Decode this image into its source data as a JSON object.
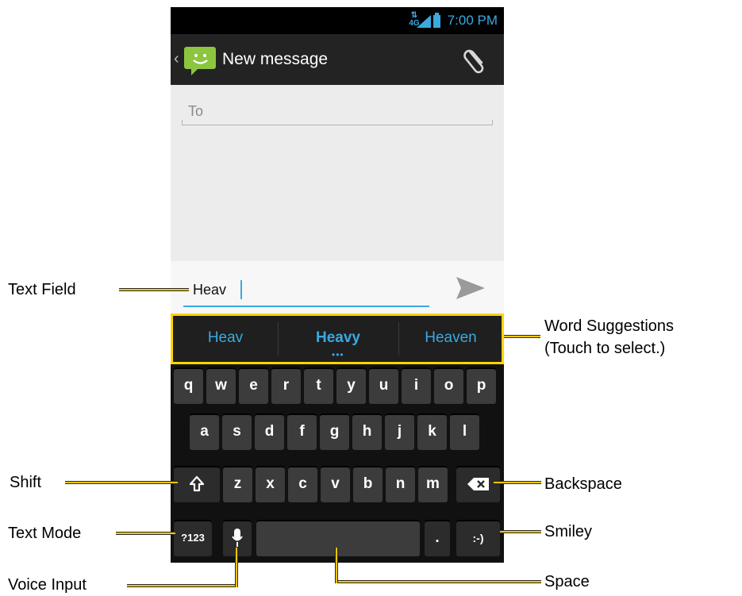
{
  "status_bar": {
    "time": "7:00 PM",
    "network": "4G"
  },
  "action_bar": {
    "title": "New message"
  },
  "compose": {
    "to_placeholder": "To",
    "text_value": "Heav"
  },
  "suggestions": [
    "Heav",
    "Heavy",
    "Heaven"
  ],
  "keyboard": {
    "row1": [
      "q",
      "w",
      "e",
      "r",
      "t",
      "y",
      "u",
      "i",
      "o",
      "p"
    ],
    "row2": [
      "a",
      "s",
      "d",
      "f",
      "g",
      "h",
      "j",
      "k",
      "l"
    ],
    "row3": [
      "z",
      "x",
      "c",
      "v",
      "b",
      "n",
      "m"
    ],
    "mode_key": "?123",
    "period_key": ".",
    "smiley_key": ":-)"
  },
  "callouts": {
    "text_field": "Text Field",
    "word_suggestions": "Word Suggestions",
    "word_suggestions_note": "(Touch to select.)",
    "shift": "Shift",
    "backspace": "Backspace",
    "text_mode": "Text Mode",
    "smiley": "Smiley",
    "voice_input": "Voice Input",
    "space": "Space"
  },
  "colors": {
    "accent": "#3aa9e0",
    "highlight": "#f2c500",
    "app_icon": "#8cc63f"
  },
  "icons": [
    "signal-icon",
    "battery-icon",
    "messaging-app-icon",
    "paperclip-icon",
    "send-icon",
    "shift-icon",
    "backspace-icon",
    "microphone-icon"
  ]
}
